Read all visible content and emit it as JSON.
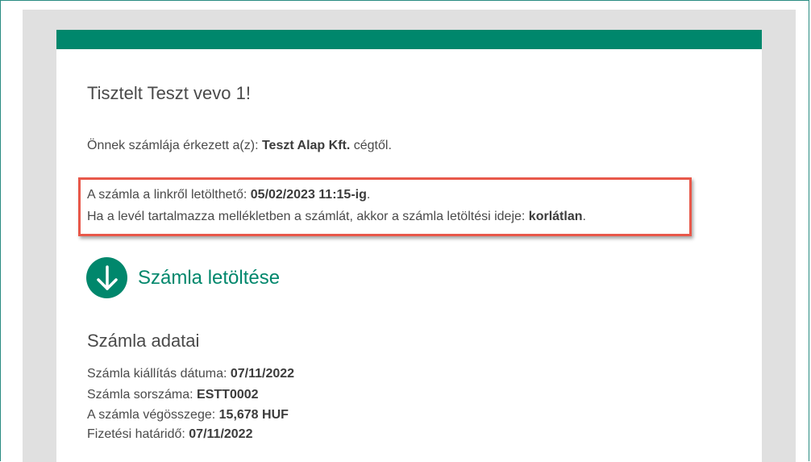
{
  "email": {
    "greeting": "Tisztelt Teszt vevo 1!",
    "received": {
      "prefix": "Önnek számlája érkezett a(z): ",
      "company": "Teszt Alap Kft.",
      "suffix": " cégtől."
    },
    "download_notice": {
      "line1_prefix": "A számla a linkről letölthető: ",
      "line1_date": "05/02/2023 11:15-ig",
      "line1_suffix": ".",
      "line2_prefix": "Ha a levél tartalmazza mellékletben a számlát, akkor a számla letöltési ideje: ",
      "line2_value": "korlátlan",
      "line2_suffix": "."
    },
    "download_button": {
      "label": "Számla letöltése",
      "icon": "arrow-down-circle-icon"
    },
    "invoice_details": {
      "title": "Számla adatai",
      "rows": [
        {
          "label": "Számla kiállítás dátuma: ",
          "value": "07/11/2022"
        },
        {
          "label": "Számla sorszáma: ",
          "value": "ESTT0002"
        },
        {
          "label": "A számla végösszege: ",
          "value": "15,678 HUF"
        },
        {
          "label": "Fizetési határidő: ",
          "value": "07/11/2022"
        }
      ]
    }
  },
  "colors": {
    "brand_green": "#00876c",
    "highlight_red": "#e8584a",
    "background_gray": "#e0e0e0",
    "text": "#4a4a4a"
  }
}
